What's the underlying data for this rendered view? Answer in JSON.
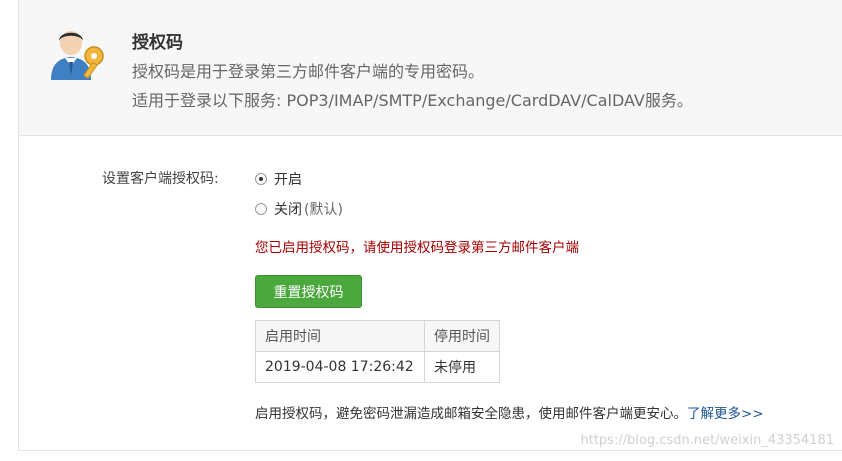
{
  "header": {
    "title": "授权码",
    "desc1": "授权码是用于登录第三方邮件客户端的专用密码。",
    "desc2": "适用于登录以下服务: POP3/IMAP/SMTP/Exchange/CardDAV/CalDAV服务。",
    "icon": "user-key-icon"
  },
  "setting": {
    "label": "设置客户端授权码:",
    "options": [
      {
        "label": "开启",
        "selected": true
      },
      {
        "label": "关闭",
        "suffix": "(默认)",
        "selected": false
      }
    ]
  },
  "notice": "您已启用授权码，请使用授权码登录第三方邮件客户端",
  "reset_button": "重置授权码",
  "table": {
    "headers": [
      "启用时间",
      "停用时间"
    ],
    "rows": [
      [
        "2019-04-08 17:26:42",
        "未停用"
      ]
    ]
  },
  "footer": {
    "text": "启用授权码，避免密码泄漏造成邮箱安全隐患，使用邮件客户端更安心。",
    "link": "了解更多>>"
  },
  "watermark": "https://blog.csdn.net/weixin_43354181",
  "colors": {
    "button_green": "#4aa83d",
    "notice_red": "#a40000",
    "link_blue": "#1e5494"
  }
}
